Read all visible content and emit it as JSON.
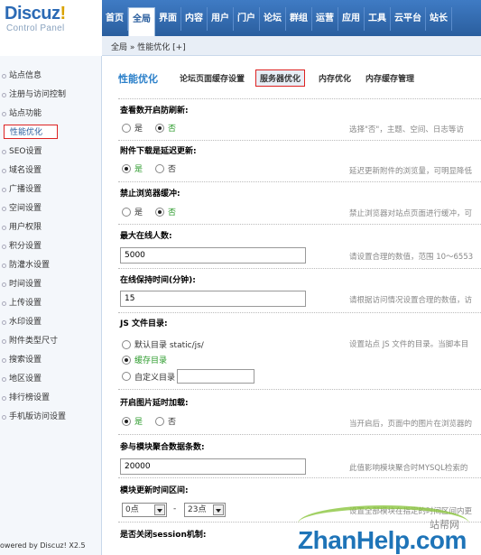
{
  "logo": {
    "name": "Discuz",
    "excl": "!",
    "sub": "Control Panel"
  },
  "topnav": [
    "首页",
    "全局",
    "界面",
    "内容",
    "用户",
    "门户",
    "论坛",
    "群组",
    "运营",
    "应用",
    "工具",
    "云平台",
    "站长"
  ],
  "breadcrumb": "全局 » 性能优化  [+]",
  "sidebar": [
    "站点信息",
    "注册与访问控制",
    "站点功能",
    "性能优化",
    "SEO设置",
    "域名设置",
    "广播设置",
    "空间设置",
    "用户权限",
    "积分设置",
    "防灌水设置",
    "时间设置",
    "上传设置",
    "水印设置",
    "附件类型尺寸",
    "搜索设置",
    "地区设置",
    "排行榜设置",
    "手机版访问设置"
  ],
  "powered": "owered by Discuz! X2.5",
  "tabs": {
    "title": "性能优化",
    "items": [
      "论坛页面缓存设置",
      "服务器优化",
      "内存优化",
      "内存缓存管理"
    ]
  },
  "sections": {
    "s1": {
      "label": "查看数开启防刷新:",
      "yes": "是",
      "no": "否",
      "hint": "选择\"否\"，主题、空间、日志等访"
    },
    "s2": {
      "label": "附件下载是延迟更新:",
      "yes": "是",
      "no": "否",
      "hint": "延迟更新附件的浏览量，可明显降低"
    },
    "s3": {
      "label": "禁止浏览器缓冲:",
      "yes": "是",
      "no": "否",
      "hint": "禁止浏览器对站点页面进行缓冲，可"
    },
    "s4": {
      "label": "最大在线人数:",
      "value": "5000",
      "hint": "请设置合理的数值，范围 10～6553"
    },
    "s5": {
      "label": "在线保持时间(分钟):",
      "value": "15",
      "hint": "请根据访问情况设置合理的数值，访"
    },
    "s6": {
      "label": "JS 文件目录:",
      "opt1": "默认目录 static/js/",
      "opt2": "缓存目录",
      "opt3": "自定义目录",
      "hint": "设置站点 JS 文件的目录。当脚本目"
    },
    "s7": {
      "label": "开启图片延时加载:",
      "yes": "是",
      "no": "否",
      "hint": "当开启后，页面中的图片在浏览器的"
    },
    "s8": {
      "label": "参与模块聚合数据条数:",
      "value": "20000",
      "hint": "此值影响模块聚合时MYSQL检索的"
    },
    "s9": {
      "label": "模块更新时间区间:",
      "from": "0点",
      "dash": "-",
      "to": "23点",
      "hint": "设置全部模块在指定的时间区间内更"
    },
    "s10": {
      "label": "是否关闭session机制:"
    }
  },
  "watermark": {
    "text": "ZhanHelp.com",
    "cn": "站帮网"
  }
}
